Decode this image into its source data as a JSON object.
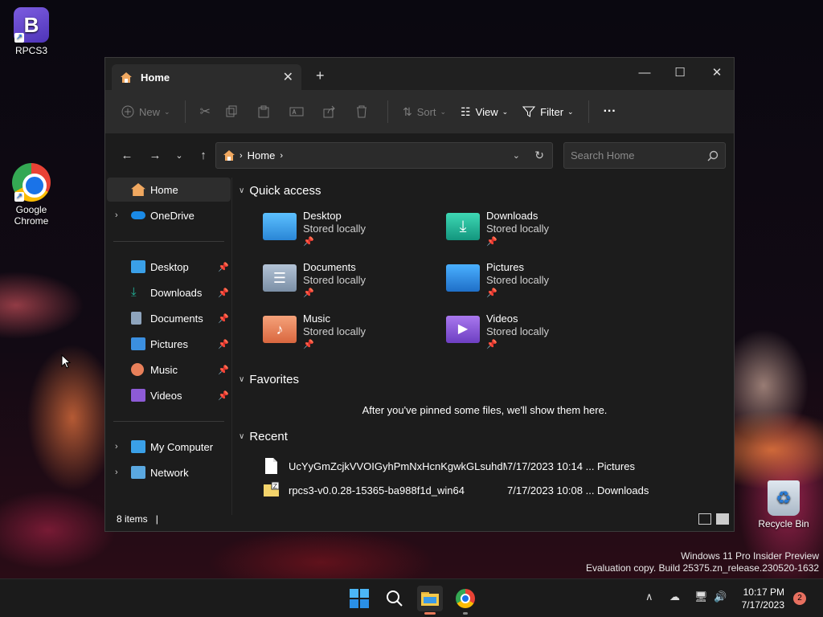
{
  "desktop": {
    "icons": [
      {
        "label": "RPCS3"
      },
      {
        "label": "Google Chrome"
      },
      {
        "label": "Recycle Bin"
      }
    ],
    "watermark_line1": "Windows 11 Pro Insider Preview",
    "watermark_line2": "Evaluation copy. Build 25375.zn_release.230520-1632"
  },
  "window": {
    "tab_title": "Home",
    "toolbar": {
      "new": "New",
      "sort": "Sort",
      "view": "View",
      "filter": "Filter",
      "more": "···"
    },
    "address": {
      "crumb": "Home"
    },
    "search": {
      "placeholder": "Search Home"
    },
    "sidebar": {
      "home": "Home",
      "onedrive": "OneDrive",
      "pinned": [
        "Desktop",
        "Downloads",
        "Documents",
        "Pictures",
        "Music",
        "Videos"
      ],
      "my_computer": "My Computer",
      "network": "Network"
    },
    "quick_access": {
      "title": "Quick access",
      "items": [
        {
          "name": "Desktop",
          "sub": "Stored locally",
          "color": "#3aa0e8"
        },
        {
          "name": "Downloads",
          "sub": "Stored locally",
          "color": "#22b59a"
        },
        {
          "name": "Documents",
          "sub": "Stored locally",
          "color": "#8ea4bd"
        },
        {
          "name": "Pictures",
          "sub": "Stored locally",
          "color": "#3b8fe0"
        },
        {
          "name": "Music",
          "sub": "Stored locally",
          "color": "#e8805a"
        },
        {
          "name": "Videos",
          "sub": "Stored locally",
          "color": "#8d5bd6"
        }
      ]
    },
    "favorites": {
      "title": "Favorites",
      "empty": "After you've pinned some files, we'll show them here."
    },
    "recent": {
      "title": "Recent",
      "rows": [
        {
          "name": "UcYyGmZcjkVVOIGyhPmNxHcnKgwkGLsuhdMa...",
          "date": "7/17/2023 10:14 ...",
          "location": "Pictures"
        },
        {
          "name": "rpcs3-v0.0.28-15365-ba988f1d_win64",
          "date": "7/17/2023 10:08 ...",
          "location": "Downloads"
        }
      ]
    },
    "status": "8 items"
  },
  "taskbar": {
    "time": "10:17 PM",
    "date": "7/17/2023",
    "notification_count": "2"
  }
}
